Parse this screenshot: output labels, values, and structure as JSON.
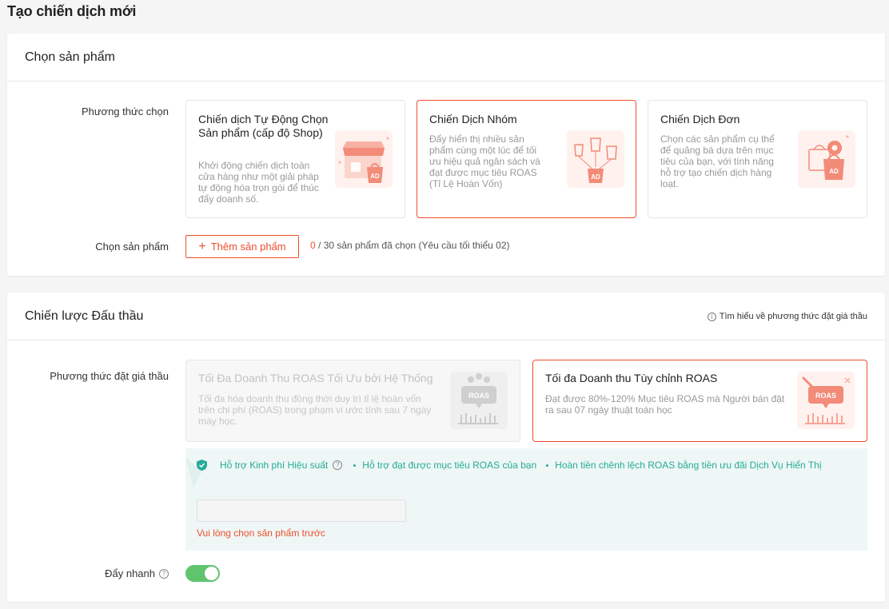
{
  "page_title": "Tạo chiến dịch mới",
  "product_section": {
    "title": "Chọn sản phẩm",
    "method_label": "Phương thức chọn",
    "options": [
      {
        "title": "Chiến dịch Tự Động Chọn Sản phẩm (cấp độ Shop)",
        "desc": "Khởi động chiến dịch toàn cửa hàng như một giải pháp tự động hóa trọn gói để thúc đẩy doanh số.",
        "icon": "shop-ad-icon",
        "selected": false
      },
      {
        "title": "Chiến Dịch Nhóm",
        "desc": "Đẩy hiển thị nhiều sản phẩm cùng một lúc để tối ưu hiệu quả ngân sách và đạt được mục tiêu ROAS (Tỉ Lệ Hoàn Vốn)",
        "icon": "shopping-bags-ad-icon",
        "selected": true
      },
      {
        "title": "Chiến Dịch Đơn",
        "desc": "Chọn các sản phẩm cụ thể để quảng bá dựa trên mục tiêu của bạn, với tính năng hỗ trợ tạo chiến dịch hàng loạt.",
        "icon": "bag-gear-ad-icon",
        "selected": false
      }
    ],
    "pick_label": "Chọn sản phẩm",
    "add_button": "Thêm sản phẩm",
    "count_selected": "0",
    "count_rest": " / 30 sản phẩm đã chọn (Yêu cầu tối thiểu 02)"
  },
  "bidding_section": {
    "title": "Chiến lược Đấu thầu",
    "help_link": "Tìm hiểu về phương thức đặt giá thầu",
    "method_label": "Phương thức đặt giá thầu",
    "options": [
      {
        "title": "Tối Đa Doanh Thu ROAS Tối Ưu bởi Hệ Thống",
        "desc": "Tối đa hóa doanh thu đồng thời duy trì tỉ lệ hoàn vốn trên chi phí (ROAS) trong phạm vi ước tính sau 7 ngày máy học.",
        "icon": "roas-chart-icon",
        "disabled": true
      },
      {
        "title": "Tối đa Doanh thu Tùy chỉnh ROAS",
        "desc": "Đạt được 80%-120% Mục tiêu ROAS mà Người bán đặt ra sau 07 ngày thuật toán học",
        "icon": "roas-edit-icon",
        "selected": true
      }
    ],
    "support": {
      "main": "Hỗ trợ Kinh phí Hiệu suất",
      "bullets": [
        "Hỗ trợ đạt được mục tiêu ROAS của bạn",
        "Hoàn tiền chênh lệch ROAS bằng tiền ưu đãi Dịch Vụ Hiển Thị"
      ]
    },
    "budget_input_value": "",
    "error": "Vui lòng chọn sản phẩm trước",
    "boost_label": "Đẩy nhanh",
    "boost_on": true
  },
  "colors": {
    "accent": "#ee4d2d",
    "teal": "#26aa99",
    "toggle": "#5fc46d"
  }
}
